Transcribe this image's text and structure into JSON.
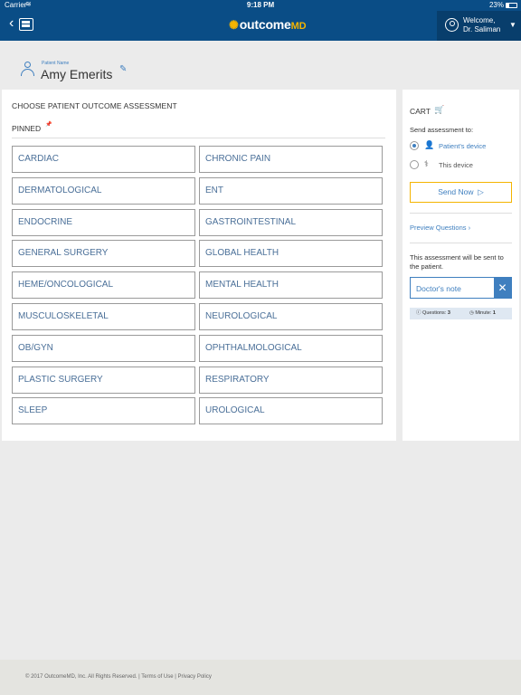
{
  "status_bar": {
    "carrier": "Carrier",
    "time": "9:18 PM",
    "battery": "23%"
  },
  "navbar": {
    "logo_main": "outcome",
    "logo_suffix": "MD",
    "welcome_line1": "Welcome,",
    "welcome_line2": "Dr. Saliman"
  },
  "patient": {
    "label": "Patient Name",
    "name": "Amy Emerits"
  },
  "main": {
    "title": "CHOOSE PATIENT OUTCOME ASSESSMENT",
    "pinned_label": "PINNED",
    "categories": [
      "CARDIAC",
      "CHRONIC PAIN",
      "DERMATOLOGICAL",
      "ENT",
      "ENDOCRINE",
      "GASTROINTESTINAL",
      "GENERAL SURGERY",
      "GLOBAL HEALTH",
      "HEME/ONCOLOGICAL",
      "MENTAL HEALTH",
      "MUSCULOSKELETAL",
      "NEUROLOGICAL",
      "OB/GYN",
      "OPHTHALMOLOGICAL",
      "PLASTIC SURGERY",
      "RESPIRATORY",
      "SLEEP",
      "UROLOGICAL"
    ]
  },
  "cart": {
    "title": "CART",
    "send_to_label": "Send assessment to:",
    "option_patient": "Patient's device",
    "option_this": "This device",
    "send_button": "Send Now",
    "preview_link": "Preview Questions ›",
    "sent_note": "This assessment will be sent to the patient.",
    "doctor_note": "Doctor's note",
    "questions_label": "Questions:",
    "questions_value": "3",
    "minute_label": "Minute:",
    "minute_value": "1"
  },
  "footer": {
    "text": "© 2017 OutcomeMD, Inc. All Rights Reserved. | Terms of Use | Privacy Policy"
  },
  "colors": {
    "nav": "#0a4d86",
    "accent": "#f4b400",
    "link": "#3f7fbf"
  }
}
